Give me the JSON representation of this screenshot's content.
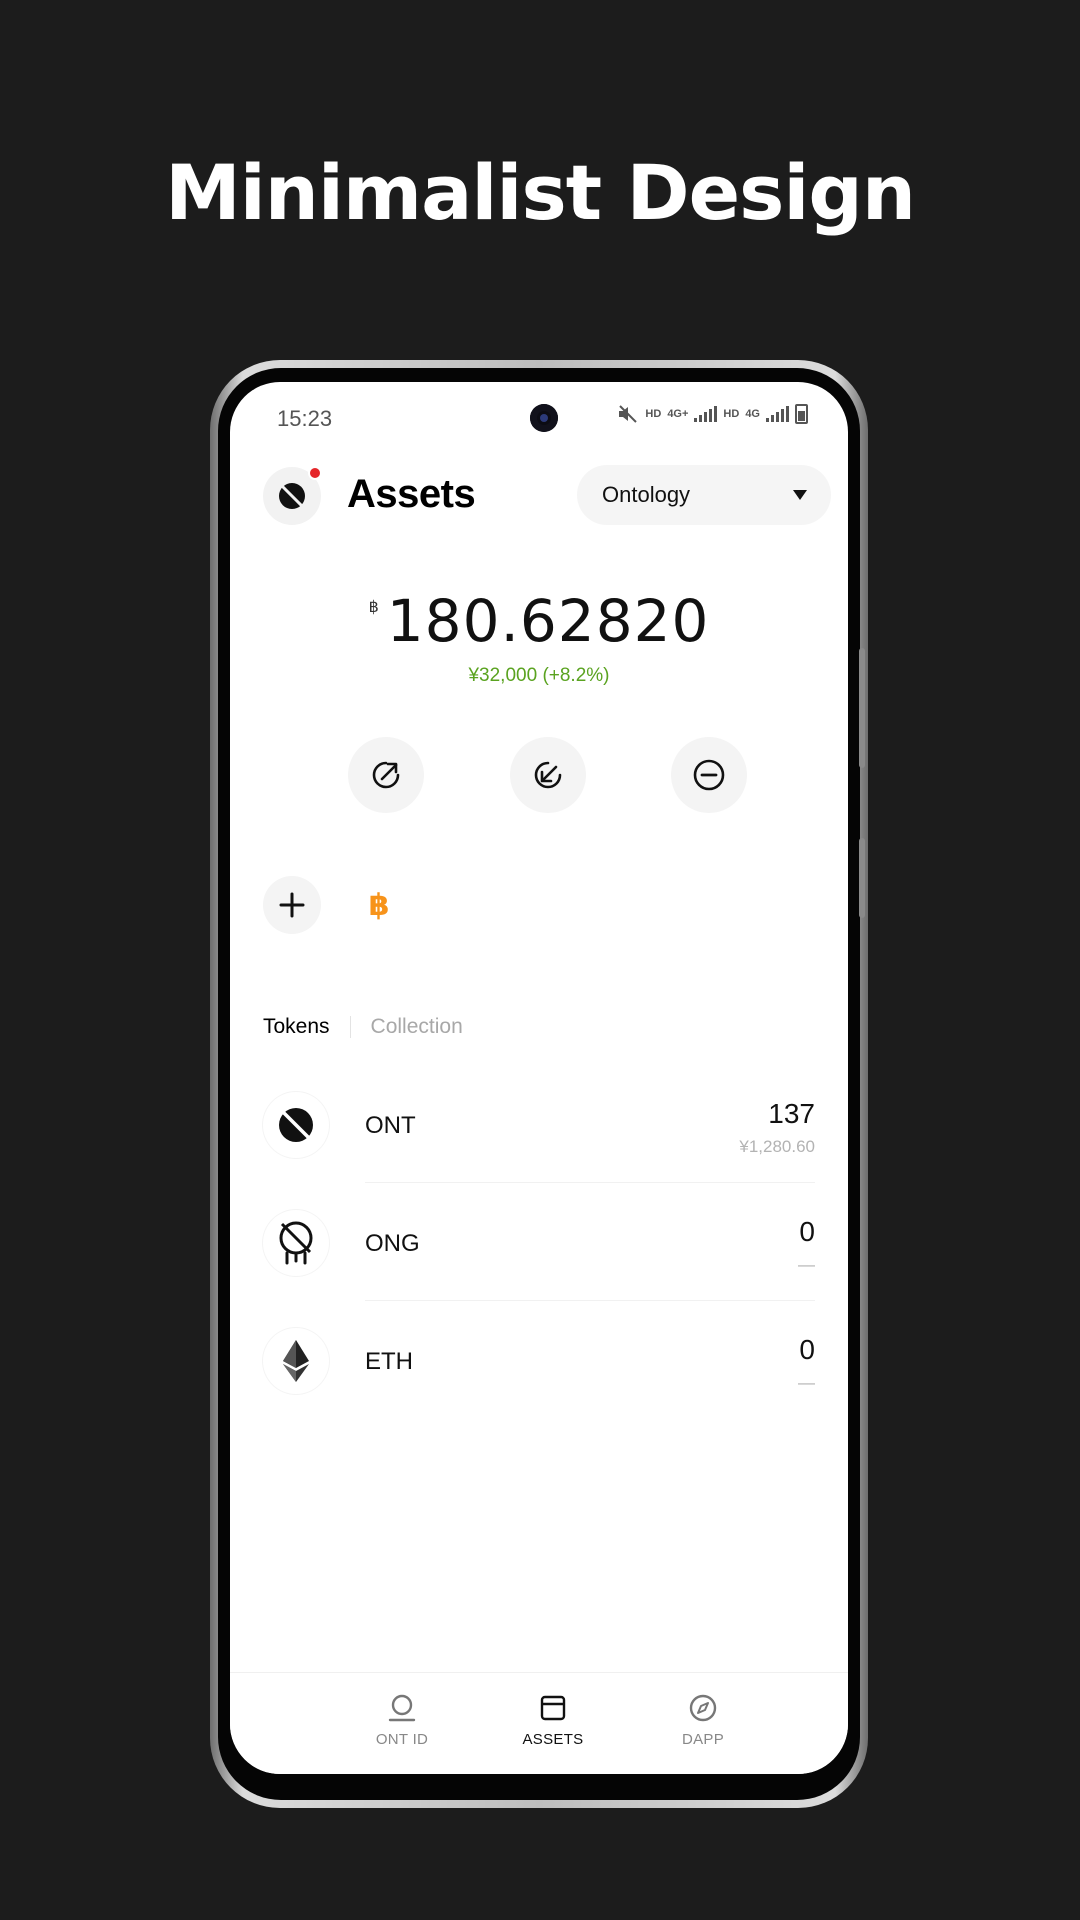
{
  "headline": "Minimalist Design",
  "status_bar": {
    "time": "15:23",
    "network_labels": [
      "HD",
      "4G+",
      "HD",
      "4G"
    ],
    "icons": [
      "mute-icon",
      "signal-icon",
      "battery-icon"
    ]
  },
  "header": {
    "title": "Assets",
    "network_selector": {
      "selected": "Ontology"
    }
  },
  "balance": {
    "currency_symbol": "฿",
    "amount": "180.62820",
    "fiat_change": "¥32,000 (+8.2%)"
  },
  "actions": [
    {
      "name": "send",
      "icon": "send-arrow-icon"
    },
    {
      "name": "receive",
      "icon": "receive-arrow-icon"
    },
    {
      "name": "withdraw",
      "icon": "minus-circle-icon"
    }
  ],
  "quick_assets": [
    "add-icon",
    "bitcoin-icon"
  ],
  "tabs": {
    "active": "Tokens",
    "inactive": "Collection"
  },
  "tokens": [
    {
      "symbol": "ONT",
      "amount": "137",
      "fiat": "¥1,280.60",
      "icon": "ont-icon"
    },
    {
      "symbol": "ONG",
      "amount": "0",
      "fiat": "—",
      "icon": "ong-icon"
    },
    {
      "symbol": "ETH",
      "amount": "0",
      "fiat": "—",
      "icon": "eth-icon"
    }
  ],
  "bottom_nav": [
    {
      "label": "ONT ID",
      "icon": "user-icon",
      "active": false
    },
    {
      "label": "ASSETS",
      "icon": "wallet-icon",
      "active": true
    },
    {
      "label": "DAPP",
      "icon": "compass-icon",
      "active": false
    }
  ],
  "colors": {
    "background": "#1c1c1c",
    "accent_green": "#5aa320",
    "bitcoin_orange": "#f7931a",
    "notification_red": "#e5262a"
  }
}
